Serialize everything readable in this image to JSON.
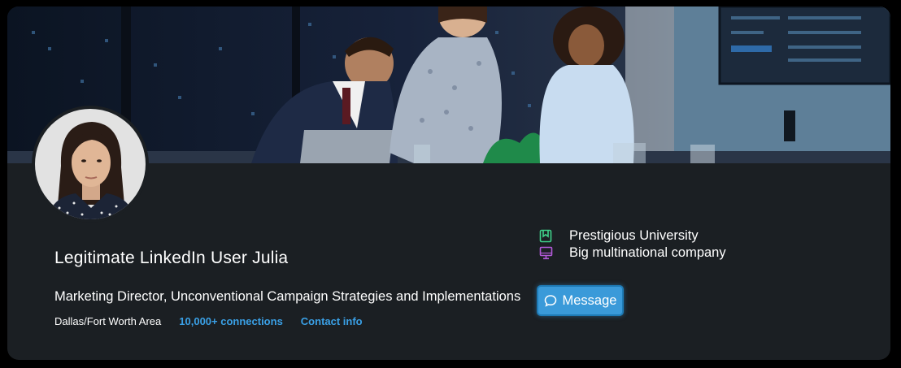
{
  "profile": {
    "name": "Legitimate LinkedIn User Julia",
    "headline": "Marketing Director, Unconventional Campaign Strategies and Implementations",
    "location": "Dallas/Fort Worth Area",
    "connections": "10,000+ connections",
    "contact": "Contact info"
  },
  "experience": {
    "school": "Prestigious University",
    "company": "Big multinational company"
  },
  "actions": {
    "message_label": "Message"
  },
  "icons": {
    "school": "bookmark-icon",
    "company": "monitor-icon",
    "message": "chat-bubble-icon"
  },
  "colors": {
    "card_bg": "#1b1f23",
    "link": "#3aa0e6",
    "button": "#3a9ad9",
    "school_icon": "#3fd18a",
    "company_icon": "#b25ad8"
  }
}
